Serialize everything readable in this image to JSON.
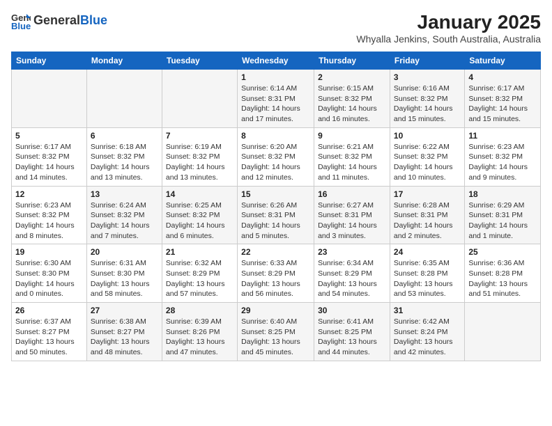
{
  "logo": {
    "general": "General",
    "blue": "Blue"
  },
  "title": "January 2025",
  "subtitle": "Whyalla Jenkins, South Australia, Australia",
  "weekdays": [
    "Sunday",
    "Monday",
    "Tuesday",
    "Wednesday",
    "Thursday",
    "Friday",
    "Saturday"
  ],
  "weeks": [
    [
      {
        "day": "",
        "detail": ""
      },
      {
        "day": "",
        "detail": ""
      },
      {
        "day": "",
        "detail": ""
      },
      {
        "day": "1",
        "detail": "Sunrise: 6:14 AM\nSunset: 8:31 PM\nDaylight: 14 hours\nand 17 minutes."
      },
      {
        "day": "2",
        "detail": "Sunrise: 6:15 AM\nSunset: 8:32 PM\nDaylight: 14 hours\nand 16 minutes."
      },
      {
        "day": "3",
        "detail": "Sunrise: 6:16 AM\nSunset: 8:32 PM\nDaylight: 14 hours\nand 15 minutes."
      },
      {
        "day": "4",
        "detail": "Sunrise: 6:17 AM\nSunset: 8:32 PM\nDaylight: 14 hours\nand 15 minutes."
      }
    ],
    [
      {
        "day": "5",
        "detail": "Sunrise: 6:17 AM\nSunset: 8:32 PM\nDaylight: 14 hours\nand 14 minutes."
      },
      {
        "day": "6",
        "detail": "Sunrise: 6:18 AM\nSunset: 8:32 PM\nDaylight: 14 hours\nand 13 minutes."
      },
      {
        "day": "7",
        "detail": "Sunrise: 6:19 AM\nSunset: 8:32 PM\nDaylight: 14 hours\nand 13 minutes."
      },
      {
        "day": "8",
        "detail": "Sunrise: 6:20 AM\nSunset: 8:32 PM\nDaylight: 14 hours\nand 12 minutes."
      },
      {
        "day": "9",
        "detail": "Sunrise: 6:21 AM\nSunset: 8:32 PM\nDaylight: 14 hours\nand 11 minutes."
      },
      {
        "day": "10",
        "detail": "Sunrise: 6:22 AM\nSunset: 8:32 PM\nDaylight: 14 hours\nand 10 minutes."
      },
      {
        "day": "11",
        "detail": "Sunrise: 6:23 AM\nSunset: 8:32 PM\nDaylight: 14 hours\nand 9 minutes."
      }
    ],
    [
      {
        "day": "12",
        "detail": "Sunrise: 6:23 AM\nSunset: 8:32 PM\nDaylight: 14 hours\nand 8 minutes."
      },
      {
        "day": "13",
        "detail": "Sunrise: 6:24 AM\nSunset: 8:32 PM\nDaylight: 14 hours\nand 7 minutes."
      },
      {
        "day": "14",
        "detail": "Sunrise: 6:25 AM\nSunset: 8:32 PM\nDaylight: 14 hours\nand 6 minutes."
      },
      {
        "day": "15",
        "detail": "Sunrise: 6:26 AM\nSunset: 8:31 PM\nDaylight: 14 hours\nand 5 minutes."
      },
      {
        "day": "16",
        "detail": "Sunrise: 6:27 AM\nSunset: 8:31 PM\nDaylight: 14 hours\nand 3 minutes."
      },
      {
        "day": "17",
        "detail": "Sunrise: 6:28 AM\nSunset: 8:31 PM\nDaylight: 14 hours\nand 2 minutes."
      },
      {
        "day": "18",
        "detail": "Sunrise: 6:29 AM\nSunset: 8:31 PM\nDaylight: 14 hours\nand 1 minute."
      }
    ],
    [
      {
        "day": "19",
        "detail": "Sunrise: 6:30 AM\nSunset: 8:30 PM\nDaylight: 14 hours\nand 0 minutes."
      },
      {
        "day": "20",
        "detail": "Sunrise: 6:31 AM\nSunset: 8:30 PM\nDaylight: 13 hours\nand 58 minutes."
      },
      {
        "day": "21",
        "detail": "Sunrise: 6:32 AM\nSunset: 8:29 PM\nDaylight: 13 hours\nand 57 minutes."
      },
      {
        "day": "22",
        "detail": "Sunrise: 6:33 AM\nSunset: 8:29 PM\nDaylight: 13 hours\nand 56 minutes."
      },
      {
        "day": "23",
        "detail": "Sunrise: 6:34 AM\nSunset: 8:29 PM\nDaylight: 13 hours\nand 54 minutes."
      },
      {
        "day": "24",
        "detail": "Sunrise: 6:35 AM\nSunset: 8:28 PM\nDaylight: 13 hours\nand 53 minutes."
      },
      {
        "day": "25",
        "detail": "Sunrise: 6:36 AM\nSunset: 8:28 PM\nDaylight: 13 hours\nand 51 minutes."
      }
    ],
    [
      {
        "day": "26",
        "detail": "Sunrise: 6:37 AM\nSunset: 8:27 PM\nDaylight: 13 hours\nand 50 minutes."
      },
      {
        "day": "27",
        "detail": "Sunrise: 6:38 AM\nSunset: 8:27 PM\nDaylight: 13 hours\nand 48 minutes."
      },
      {
        "day": "28",
        "detail": "Sunrise: 6:39 AM\nSunset: 8:26 PM\nDaylight: 13 hours\nand 47 minutes."
      },
      {
        "day": "29",
        "detail": "Sunrise: 6:40 AM\nSunset: 8:25 PM\nDaylight: 13 hours\nand 45 minutes."
      },
      {
        "day": "30",
        "detail": "Sunrise: 6:41 AM\nSunset: 8:25 PM\nDaylight: 13 hours\nand 44 minutes."
      },
      {
        "day": "31",
        "detail": "Sunrise: 6:42 AM\nSunset: 8:24 PM\nDaylight: 13 hours\nand 42 minutes."
      },
      {
        "day": "",
        "detail": ""
      }
    ]
  ]
}
